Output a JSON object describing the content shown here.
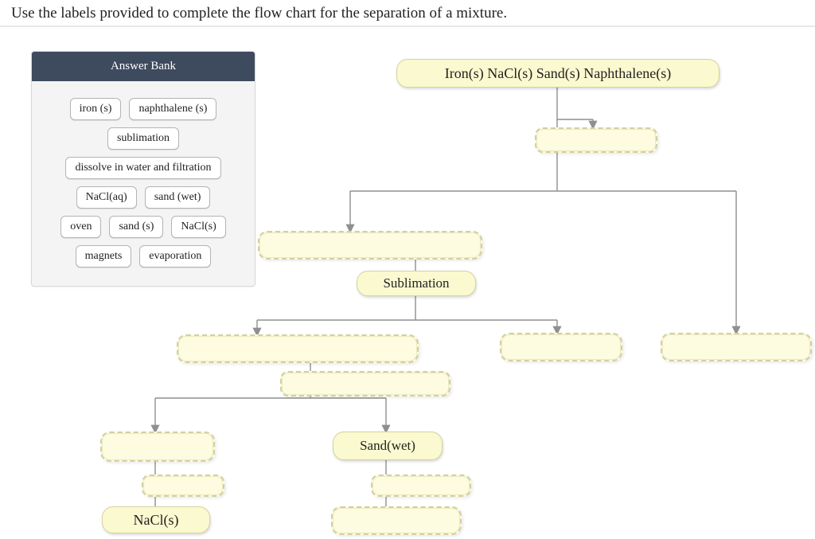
{
  "instruction": "Use the labels provided to complete the flow chart for the separation of a mixture.",
  "bank": {
    "title": "Answer Bank",
    "rows": [
      [
        "iron (s)",
        "naphthalene (s)"
      ],
      [
        "sublimation"
      ],
      [
        "dissolve in water and filtration"
      ],
      [
        "NaCl(aq)",
        "sand (wet)"
      ],
      [
        "oven",
        "sand (s)",
        "NaCl(s)"
      ],
      [
        "magnets",
        "evaporation"
      ]
    ]
  },
  "nodes": {
    "start": "Iron(s)  NaCl(s)  Sand(s)  Naphthalene(s)",
    "sublimation": "Sublimation",
    "sandwet": "Sand(wet)",
    "nacls": "NaCl(s)"
  }
}
